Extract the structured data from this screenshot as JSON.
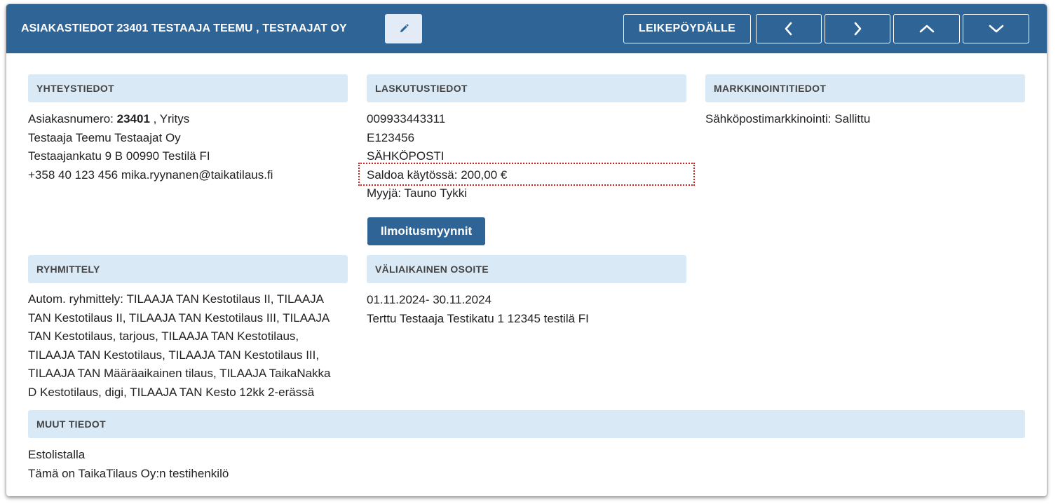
{
  "header": {
    "title": "ASIAKASTIEDOT 23401 TESTAAJA TEEMU , TESTAAJAT OY",
    "clipboard_label": "LEIKEPÖYDÄLLE"
  },
  "contact": {
    "heading": "YHTEYSTIEDOT",
    "customer_number_label": "Asiakasnumero: ",
    "customer_number": "23401",
    "customer_type": " , Yritys",
    "name": "Testaaja Teemu Testaajat Oy",
    "address": "Testaajankatu 9 B 00990 Testilä FI",
    "phone_email": "+358 40 123 456 mika.ryynanen@taikatilaus.fi"
  },
  "billing": {
    "heading": "LASKUTUSTIEDOT",
    "line1": "009933443311",
    "line2": "E123456",
    "line3": "SÄHKÖPOSTI",
    "balance": "Saldoa käytössä: 200,00 €",
    "seller": "Myyjä: Tauno Tykki",
    "ads_button": "Ilmoitusmyynnit"
  },
  "marketing": {
    "heading": "MARKKINOINTITIEDOT",
    "email_marketing": "Sähköpostimarkkinointi: Sallittu"
  },
  "grouping": {
    "heading": "RYHMITTELY",
    "lines": [
      "Autom. ryhmittely: TILAAJA TAN Kestotilaus II, TILAAJA",
      "TAN Kestotilaus II, TILAAJA TAN Kestotilaus III, TILAAJA",
      "TAN Kestotilaus, tarjous, TILAAJA TAN Kestotilaus,",
      "TILAAJA TAN Kestotilaus, TILAAJA TAN Kestotilaus III,",
      "TILAAJA TAN Määräaikainen tilaus, TILAAJA TaikaNakka",
      "D Kestotilaus, digi, TILAAJA TAN Kesto 12kk 2-erässä"
    ]
  },
  "temp_address": {
    "heading": "VÄLIAIKAINEN OSOITE",
    "dates": "01.11.2024- 30.11.2024",
    "address": "Terttu Testaaja Testikatu 1 12345 testilä FI"
  },
  "other": {
    "heading": "MUUT TIEDOT",
    "line1": "Estolistalla",
    "line2": "Tämä on TaikaTilaus Oy:n testihenkilö"
  },
  "colors": {
    "header_bg": "#2f6496",
    "section_bg": "#d9eaf6",
    "highlight": "#d21f1f"
  },
  "icons": {
    "edit": "pencil-icon",
    "prev": "chevron-left-icon",
    "next": "chevron-right-icon",
    "up": "chevron-up-icon",
    "down": "chevron-down-icon"
  }
}
